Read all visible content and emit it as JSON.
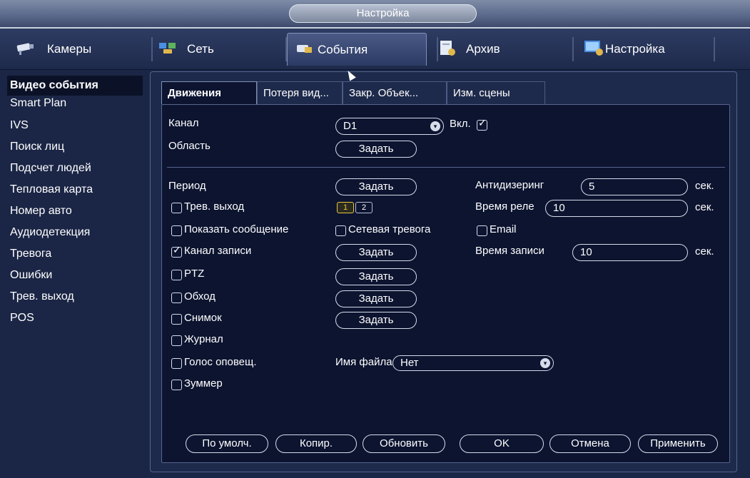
{
  "window": {
    "title": "Настройка"
  },
  "topnav": [
    {
      "label": "Камеры",
      "icon": "camera-icon"
    },
    {
      "label": "Сеть",
      "icon": "network-icon"
    },
    {
      "label": "События",
      "icon": "events-icon",
      "active": true
    },
    {
      "label": "Архив",
      "icon": "storage-icon"
    },
    {
      "label": "Настройка",
      "icon": "system-icon"
    }
  ],
  "sidebar": {
    "items": [
      {
        "label": "Видео события",
        "active": true
      },
      {
        "label": "Smart Plan"
      },
      {
        "label": "IVS"
      },
      {
        "label": "Поиск лиц"
      },
      {
        "label": "Подсчет людей"
      },
      {
        "label": "Тепловая карта"
      },
      {
        "label": "Номер авто"
      },
      {
        "label": "Аудиодетекция"
      },
      {
        "label": "Тревога"
      },
      {
        "label": "Ошибки"
      },
      {
        "label": "Трев. выход"
      },
      {
        "label": "POS"
      }
    ]
  },
  "subtabs": [
    {
      "label": "Движения",
      "active": true
    },
    {
      "label": "Потеря вид..."
    },
    {
      "label": "Закр. Объек..."
    },
    {
      "label": "Изм. сцены"
    }
  ],
  "form": {
    "channel_label": "Канал",
    "channel_value": "D1",
    "enable_label": "Вкл.",
    "enable_checked": true,
    "area_label": "Область",
    "area_button": "Задать",
    "period_label": "Период",
    "period_button": "Задать",
    "antidither_label": "Антидизеринг",
    "antidither_value": "5",
    "antidither_unit": "сек.",
    "alarm_out_label": "Трев. выход",
    "alarm_out_checked": false,
    "alarm_out_channels": [
      "1",
      "2"
    ],
    "relay_time_label": "Время реле",
    "relay_time_value": "10",
    "relay_time_unit": "сек.",
    "show_message_label": "Показать сообщение",
    "net_alarm_label": "Сетевая тревога",
    "email_label": "Email",
    "record_channel_label": "Канал записи",
    "record_channel_checked": true,
    "record_channel_button": "Задать",
    "record_time_label": "Время записи",
    "record_time_value": "10",
    "record_time_unit": "сек.",
    "ptz_label": "PTZ",
    "ptz_button": "Задать",
    "tour_label": "Обход",
    "tour_button": "Задать",
    "snapshot_label": "Снимок",
    "snapshot_button": "Задать",
    "log_label": "Журнал",
    "voice_label": "Голос оповещ.",
    "filename_label": "Имя файла",
    "filename_value": "Нет",
    "buzzer_label": "Зуммер"
  },
  "buttons": {
    "default": "По умолч.",
    "copy": "Копир.",
    "refresh": "Обновить",
    "ok": "OK",
    "cancel": "Отмена",
    "apply": "Применить"
  }
}
